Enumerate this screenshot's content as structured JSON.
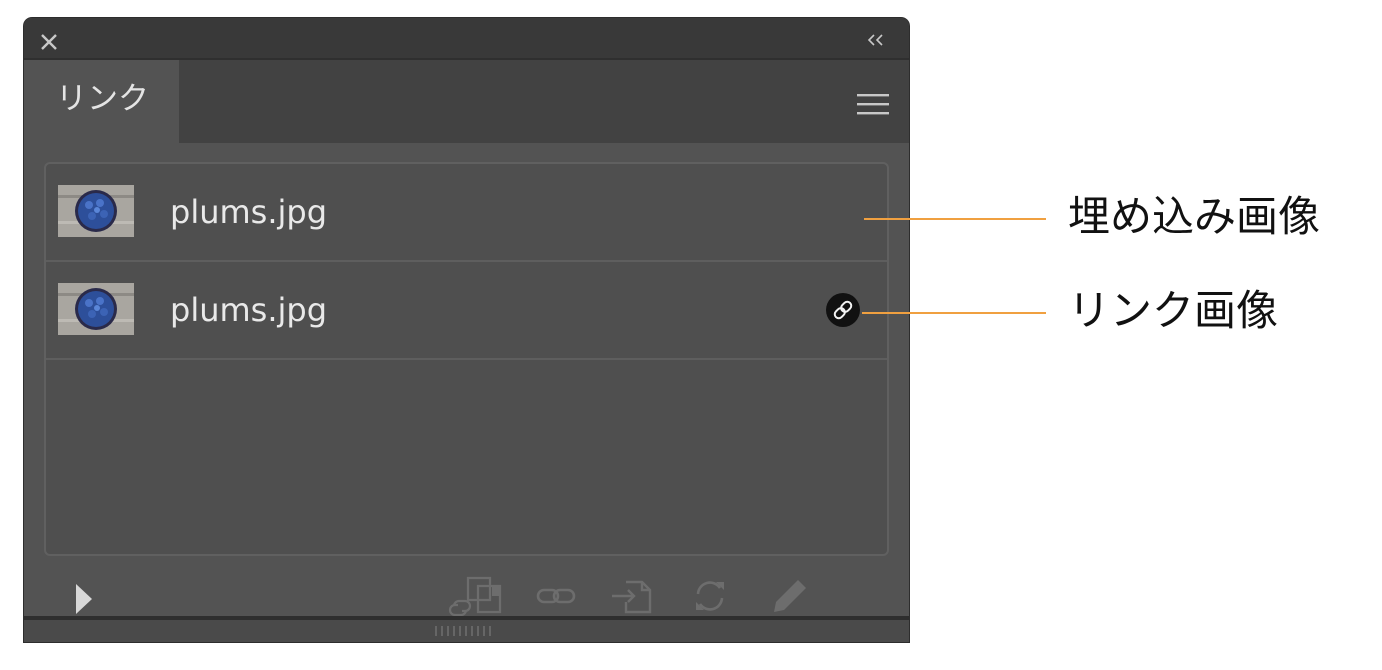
{
  "panel": {
    "tab_label": "リンク",
    "items": [
      {
        "filename": "plums.jpg",
        "type": "embedded"
      },
      {
        "filename": "plums.jpg",
        "type": "linked",
        "badge_icon": "link-icon"
      }
    ],
    "footer_icons": [
      "relink-from-library-icon",
      "relink-icon",
      "go-to-link-icon",
      "update-link-icon",
      "edit-original-icon"
    ]
  },
  "callouts": [
    {
      "label": "埋め込み画像",
      "color": "#f0a040"
    },
    {
      "label": "リンク画像",
      "color": "#f0a040"
    }
  ]
}
